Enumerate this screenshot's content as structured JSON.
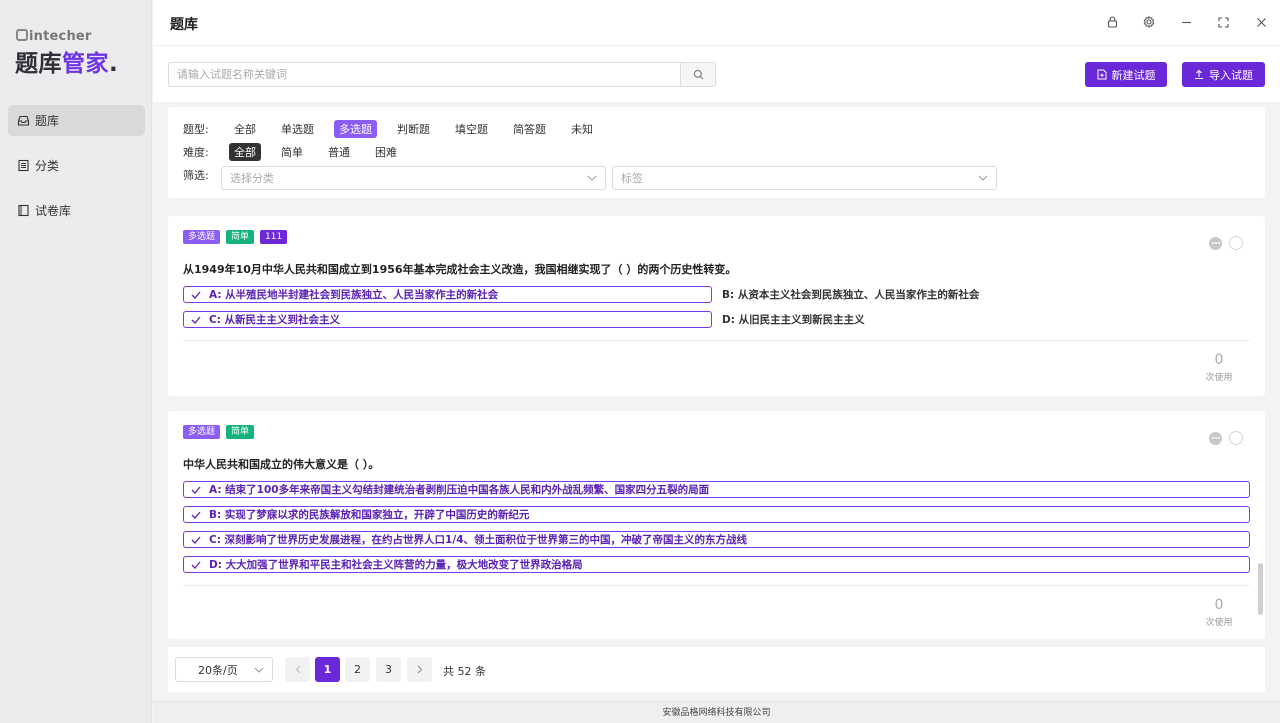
{
  "brand": {
    "small": "intecher",
    "big_prefix": "题库",
    "big_accent": "管家",
    "big_suffix": "."
  },
  "sidebar": {
    "items": [
      {
        "label": "题库",
        "icon": "inbox-icon",
        "active": true
      },
      {
        "label": "分类",
        "icon": "list-icon",
        "active": false
      },
      {
        "label": "试卷库",
        "icon": "book-icon",
        "active": false
      }
    ]
  },
  "header": {
    "title": "题库"
  },
  "toolbar": {
    "search_placeholder": "请输入试题名称关键词",
    "new_button": "新建试题",
    "import_button": "导入试题"
  },
  "filters": {
    "type_label": "题型:",
    "types": [
      "全部",
      "单选题",
      "多选题",
      "判断题",
      "填空题",
      "简答题",
      "未知"
    ],
    "selected_type": "多选题",
    "difficulty_label": "难度:",
    "difficulties": [
      "全部",
      "简单",
      "普通",
      "困难"
    ],
    "selected_difficulty": "全部",
    "filter_label": "筛选:",
    "category_placeholder": "选择分类",
    "tag_placeholder": "标签"
  },
  "questions": [
    {
      "tags": [
        "多选题",
        "简单",
        "111"
      ],
      "text": "从1949年10月中华人民共和国成立到1956年基本完成社会主义改造，我国相继实现了（ ）的两个历史性转变。",
      "options": [
        {
          "text": "A: 从半殖民地半封建社会到民族独立、人民当家作主的新社会",
          "correct": true
        },
        {
          "text": "B: 从资本主义社会到民族独立、人民当家作主的新社会",
          "correct": false
        },
        {
          "text": "C: 从新民主主义到社会主义",
          "correct": true
        },
        {
          "text": "D: 从旧民主主义到新民主主义",
          "correct": false
        }
      ],
      "usage_count": "0",
      "usage_label": "次使用"
    },
    {
      "tags": [
        "多选题",
        "简单"
      ],
      "text": "中华人民共和国成立的伟大意义是（ ）。",
      "options": [
        {
          "text": "A: 结束了100多年来帝国主义勾结封建统治者剥削压迫中国各族人民和内外战乱频繁、国家四分五裂的局面",
          "correct": true
        },
        {
          "text": "B: 实现了梦寐以求的民族解放和国家独立，开辟了中国历史的新纪元",
          "correct": true
        },
        {
          "text": "C: 深刻影响了世界历史发展进程，在约占世界人口1/4、领土面积位于世界第三的中国，冲破了帝国主义的东方战线",
          "correct": true
        },
        {
          "text": "D: 大大加强了世界和平民主和社会主义阵营的力量，极大地改变了世界政治格局",
          "correct": true
        }
      ],
      "usage_count": "0",
      "usage_label": "次使用"
    }
  ],
  "pagination": {
    "page_size": "20条/页",
    "pages": [
      "1",
      "2",
      "3"
    ],
    "current": "1",
    "total_text": "共 52 条"
  },
  "footer": {
    "text": "安徽品格网络科技有限公司"
  },
  "colors": {
    "accent": "#6b28d8",
    "tag_purple": "#8b5cf6",
    "tag_green": "#14b37d"
  }
}
